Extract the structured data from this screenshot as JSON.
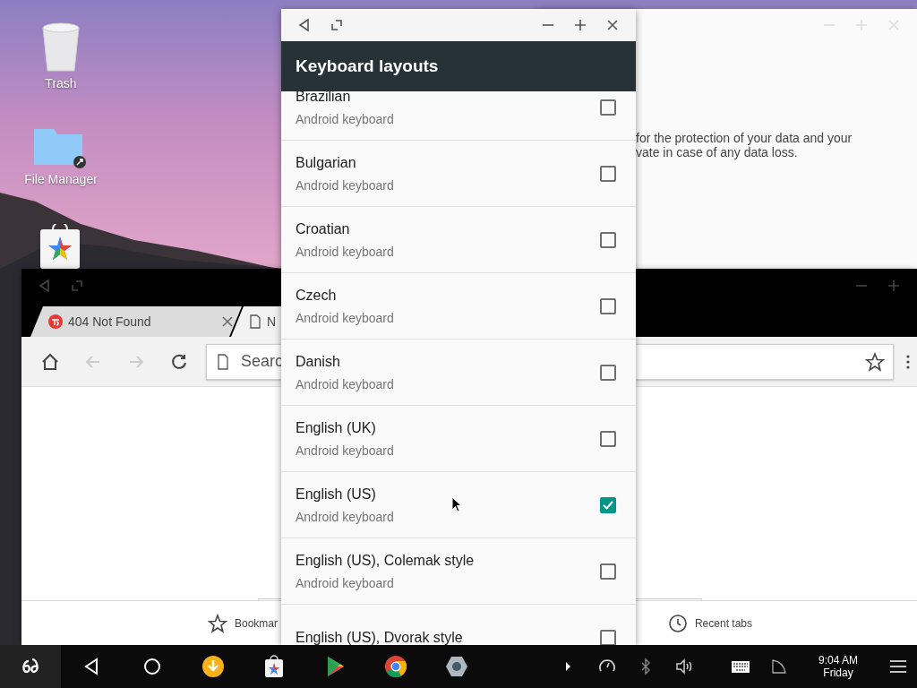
{
  "desktop_icons": [
    {
      "kind": "trash",
      "label": "Trash"
    },
    {
      "kind": "folder",
      "label": "File Manager"
    },
    {
      "kind": "store"
    }
  ],
  "back_window": {
    "text_lines": [
      "for the protection of your data and your",
      "vate in case of any data loss."
    ]
  },
  "browser": {
    "tabs": [
      {
        "title": "404 Not Found",
        "selected": false
      },
      {
        "title": "N",
        "selected": true
      }
    ],
    "nav": [
      {
        "kind": "home",
        "disabled": false
      },
      {
        "kind": "back",
        "disabled": true
      },
      {
        "kind": "forward",
        "disabled": true
      },
      {
        "kind": "reload",
        "disabled": false
      }
    ],
    "omnibox": {
      "placeholder": "Searc"
    },
    "bottom_bar": [
      {
        "kind": "bookmarks",
        "label": "Bookmar"
      },
      {
        "kind": "recent",
        "label": "Recent tabs"
      }
    ]
  },
  "keyboard_window": {
    "title": "Keyboard layouts",
    "layouts": [
      {
        "name": "Brazilian",
        "subtitle": "Android keyboard",
        "checked": false
      },
      {
        "name": "Bulgarian",
        "subtitle": "Android keyboard",
        "checked": false
      },
      {
        "name": "Croatian",
        "subtitle": "Android keyboard",
        "checked": false
      },
      {
        "name": "Czech",
        "subtitle": "Android keyboard",
        "checked": false
      },
      {
        "name": "Danish",
        "subtitle": "Android keyboard",
        "checked": false
      },
      {
        "name": "English (UK)",
        "subtitle": "Android keyboard",
        "checked": false
      },
      {
        "name": "English (US)",
        "subtitle": "Android keyboard",
        "checked": true
      },
      {
        "name": "English (US), Colemak style",
        "subtitle": "Android keyboard",
        "checked": false
      },
      {
        "name": "English (US), Dvorak style",
        "checked": false
      }
    ]
  },
  "taskbar": {
    "apps": [
      {
        "kind": "back"
      },
      {
        "kind": "home"
      },
      {
        "kind": "download"
      },
      {
        "kind": "store"
      },
      {
        "kind": "play"
      },
      {
        "kind": "chrome"
      },
      {
        "kind": "settings"
      }
    ],
    "tray": [
      {
        "kind": "expand"
      },
      {
        "kind": "gauge"
      },
      {
        "kind": "bluetooth"
      },
      {
        "kind": "volume"
      },
      {
        "kind": "keyboard"
      },
      {
        "kind": "signal"
      }
    ],
    "clock": {
      "time": "9:04 AM",
      "day": "Friday"
    }
  }
}
